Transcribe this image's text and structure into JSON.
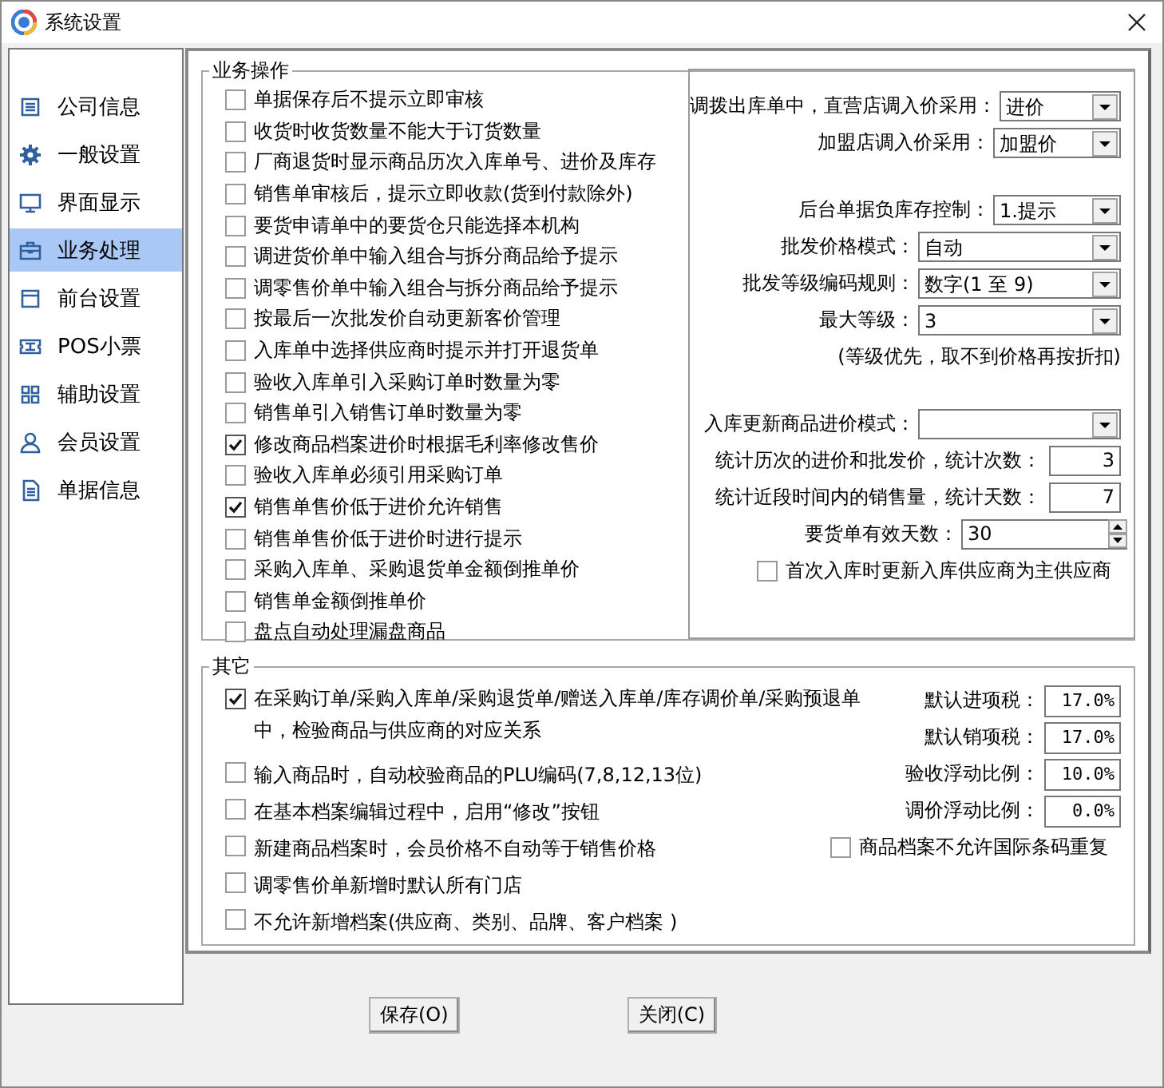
{
  "window": {
    "title": "系统设置"
  },
  "sidebar": {
    "items": [
      {
        "label": "公司信息",
        "selected": false
      },
      {
        "label": "一般设置",
        "selected": false
      },
      {
        "label": "界面显示",
        "selected": false
      },
      {
        "label": "业务处理",
        "selected": true
      },
      {
        "label": "前台设置",
        "selected": false
      },
      {
        "label": "POS小票",
        "selected": false
      },
      {
        "label": "辅助设置",
        "selected": false
      },
      {
        "label": "会员设置",
        "selected": false
      },
      {
        "label": "单据信息",
        "selected": false
      }
    ]
  },
  "business": {
    "title": "业务操作",
    "options": [
      {
        "label": "单据保存后不提示立即审核",
        "checked": false
      },
      {
        "label": "收货时收货数量不能大于订货数量",
        "checked": false
      },
      {
        "label": "厂商退货时显示商品历次入库单号、进价及库存",
        "checked": false
      },
      {
        "label": "销售单审核后，提示立即收款(货到付款除外)",
        "checked": false
      },
      {
        "label": "要货申请单中的要货仓只能选择本机构",
        "checked": false
      },
      {
        "label": "调进货价单中输入组合与拆分商品给予提示",
        "checked": false
      },
      {
        "label": "调零售价单中输入组合与拆分商品给予提示",
        "checked": false
      },
      {
        "label": "按最后一次批发价自动更新客价管理",
        "checked": false
      },
      {
        "label": "入库单中选择供应商时提示并打开退货单",
        "checked": false
      },
      {
        "label": "验收入库单引入采购订单时数量为零",
        "checked": false
      },
      {
        "label": "销售单引入销售订单时数量为零",
        "checked": false
      },
      {
        "label": "修改商品档案进价时根据毛利率修改售价",
        "checked": true
      },
      {
        "label": "验收入库单必须引用采购订单",
        "checked": false
      },
      {
        "label": "销售单售价低于进价允许销售",
        "checked": true
      },
      {
        "label": "销售单售价低于进价时进行提示",
        "checked": false
      },
      {
        "label": "采购入库单、采购退货单金额倒推单价",
        "checked": false
      },
      {
        "label": "销售单金额倒推单价",
        "checked": false
      },
      {
        "label": "盘点自动处理漏盘商品",
        "checked": false
      }
    ],
    "settings": [
      [
        {
          "kind": "select",
          "label": "调拨出库单中，直营店调入价采用：",
          "value": "进价"
        },
        {
          "kind": "select",
          "label": "加盟店调入价采用：",
          "value": "加盟价"
        }
      ],
      [
        {
          "kind": "select",
          "label": "后台单据负库存控制：",
          "value": "1.提示"
        },
        {
          "kind": "select",
          "label": "批发价格模式：",
          "value": "自动"
        },
        {
          "kind": "select",
          "label": "批发等级编码规则：",
          "value": "数字(1 至 9)"
        },
        {
          "kind": "select",
          "label": "最大等级：",
          "value": "3"
        },
        {
          "kind": "note",
          "label": "(等级优先，取不到价格再按折扣)"
        }
      ],
      [
        {
          "kind": "select",
          "label": "入库更新商品进价模式："
        },
        {
          "kind": "number",
          "label": "统计历次的进价和批发价，统计次数：",
          "value": "3"
        },
        {
          "kind": "number",
          "label": "统计近段时间内的销售量，统计天数：",
          "value": "7"
        },
        {
          "kind": "spinner",
          "label": "要货单有效天数：",
          "value": "30"
        },
        {
          "kind": "checkbox",
          "label": "首次入库时更新入库供应商为主供应商",
          "checked": false
        }
      ]
    ]
  },
  "other": {
    "title": "其它",
    "options": [
      {
        "label": "在采购订单/采购入库单/采购退货单/赠送入库单/库存调价单/采购预退单中，检验商品与供应商的对应关系",
        "checked": true
      },
      {
        "label": "输入商品时，自动校验商品的PLU编码(7,8,12,13位)",
        "checked": false
      },
      {
        "label": "在基本档案编辑过程中，启用“修改”按钮",
        "checked": false
      },
      {
        "label": "新建商品档案时，会员价格不自动等于销售价格",
        "checked": false
      },
      {
        "label": "调零售价单新增时默认所有门店",
        "checked": false
      },
      {
        "label": "不允许新增档案(供应商、类别、品牌、客户档案 )",
        "checked": false
      }
    ],
    "rates": [
      {
        "label": "默认进项税：",
        "value": "17.0%"
      },
      {
        "label": "默认销项税：",
        "value": "17.0%"
      },
      {
        "label": "验收浮动比例：",
        "value": "10.0%"
      },
      {
        "label": "调价浮动比例：",
        "value": "0.0%"
      }
    ],
    "extra_option": {
      "label": "商品档案不允许国际条码重复",
      "checked": false
    }
  },
  "buttons": [
    {
      "label": "保存(O)"
    },
    {
      "label": "关闭(C)"
    }
  ]
}
